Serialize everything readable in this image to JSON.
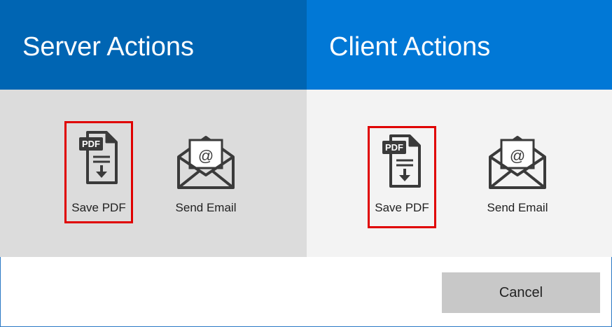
{
  "server": {
    "title": "Server Actions",
    "actions": [
      {
        "label": "Save PDF",
        "icon": "pdf-download-icon",
        "badge": "PDF",
        "selected": true
      },
      {
        "label": "Send Email",
        "icon": "email-envelope-icon",
        "selected": false
      }
    ]
  },
  "client": {
    "title": "Client Actions",
    "actions": [
      {
        "label": "Save PDF",
        "icon": "pdf-download-icon",
        "badge": "PDF",
        "selected": true
      },
      {
        "label": "Send Email",
        "icon": "email-envelope-icon",
        "selected": false
      }
    ]
  },
  "footer": {
    "cancel_label": "Cancel"
  },
  "colors": {
    "server_header": "#0065b3",
    "client_header": "#0178d6",
    "selection_border": "#e00000",
    "icon": "#3a3a3a"
  }
}
